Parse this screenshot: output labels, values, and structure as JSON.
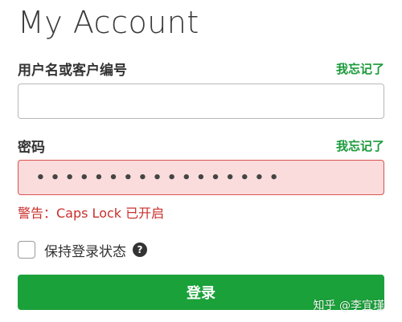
{
  "page": {
    "title": "My Account"
  },
  "username": {
    "label": "用户名或客户编号",
    "forgot": "我忘记了",
    "value": ""
  },
  "password": {
    "label": "密码",
    "forgot": "我忘记了",
    "masked_value": "•••••••••••••••••"
  },
  "warning": {
    "text": "警告：Caps Lock 已开启"
  },
  "remember": {
    "label": "保持登录状态",
    "help_glyph": "?"
  },
  "submit": {
    "label": "登录"
  },
  "watermark": {
    "text": "知乎 @李宜瑾"
  },
  "colors": {
    "accent_green": "#1ba13a",
    "link_green": "#1a9a3a",
    "error_red": "#c9302c",
    "error_bg": "#fbdcdc"
  }
}
